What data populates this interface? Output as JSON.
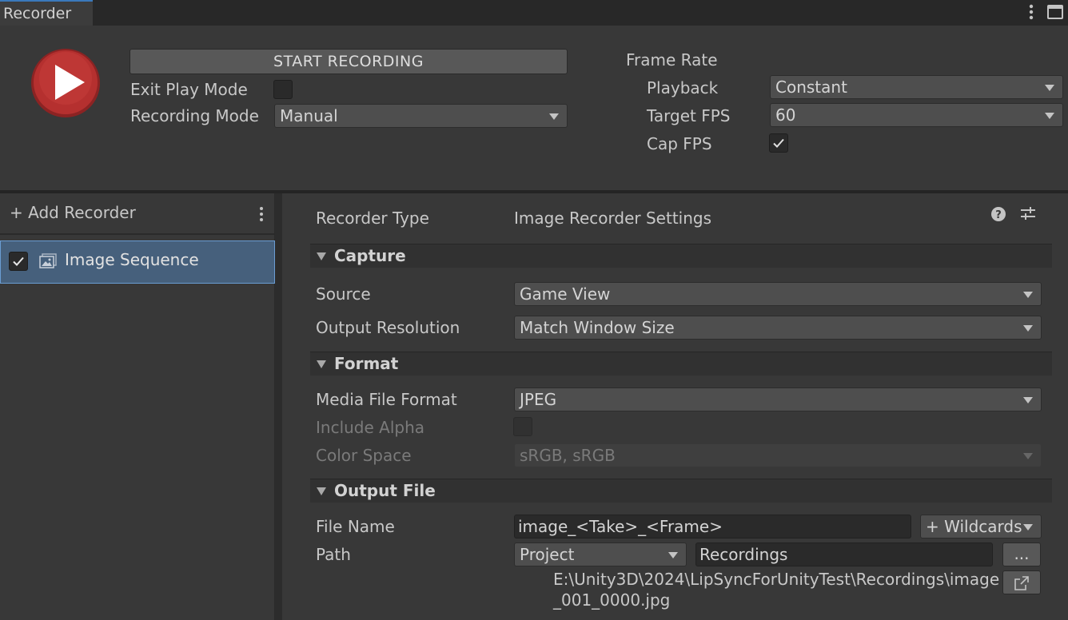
{
  "window": {
    "tab_title": "Recorder"
  },
  "controls": {
    "start_label": "START RECORDING",
    "exit_play_mode_label": "Exit Play Mode",
    "exit_play_mode_checked": false,
    "recording_mode_label": "Recording Mode",
    "recording_mode_value": "Manual",
    "frame_rate_label": "Frame Rate",
    "playback_label": "Playback",
    "playback_value": "Constant",
    "target_fps_label": "Target FPS",
    "target_fps_value": "60",
    "cap_fps_label": "Cap FPS",
    "cap_fps_checked": true
  },
  "recorder_list": {
    "add_label": "+ Add Recorder",
    "items": [
      {
        "name": "Image Sequence",
        "enabled": true,
        "selected": true
      }
    ]
  },
  "inspector": {
    "recorder_type_label": "Recorder Type",
    "recorder_type_value": "Image Recorder Settings",
    "capture": {
      "title": "Capture",
      "source_label": "Source",
      "source_value": "Game View",
      "output_resolution_label": "Output Resolution",
      "output_resolution_value": "Match Window Size"
    },
    "format": {
      "title": "Format",
      "media_file_format_label": "Media File Format",
      "media_file_format_value": "JPEG",
      "include_alpha_label": "Include Alpha",
      "include_alpha_checked": false,
      "color_space_label": "Color Space",
      "color_space_value": "sRGB, sRGB"
    },
    "output_file": {
      "title": "Output File",
      "file_name_label": "File Name",
      "file_name_value": "image_<Take>_<Frame>",
      "wildcards_label": "+ Wildcards",
      "path_label": "Path",
      "path_root_value": "Project",
      "path_folder_value": "Recordings",
      "browse_label": "...",
      "resolved_path": "E:\\Unity3D\\2024\\LipSyncForUnityTest\\Recordings\\image_001_0000.jpg"
    }
  },
  "colors": {
    "background": "#383838",
    "selection": "#46607c",
    "selection_border": "#6a9cd2",
    "record_red": "#b5302f",
    "tab_accent": "#3a79bb"
  }
}
